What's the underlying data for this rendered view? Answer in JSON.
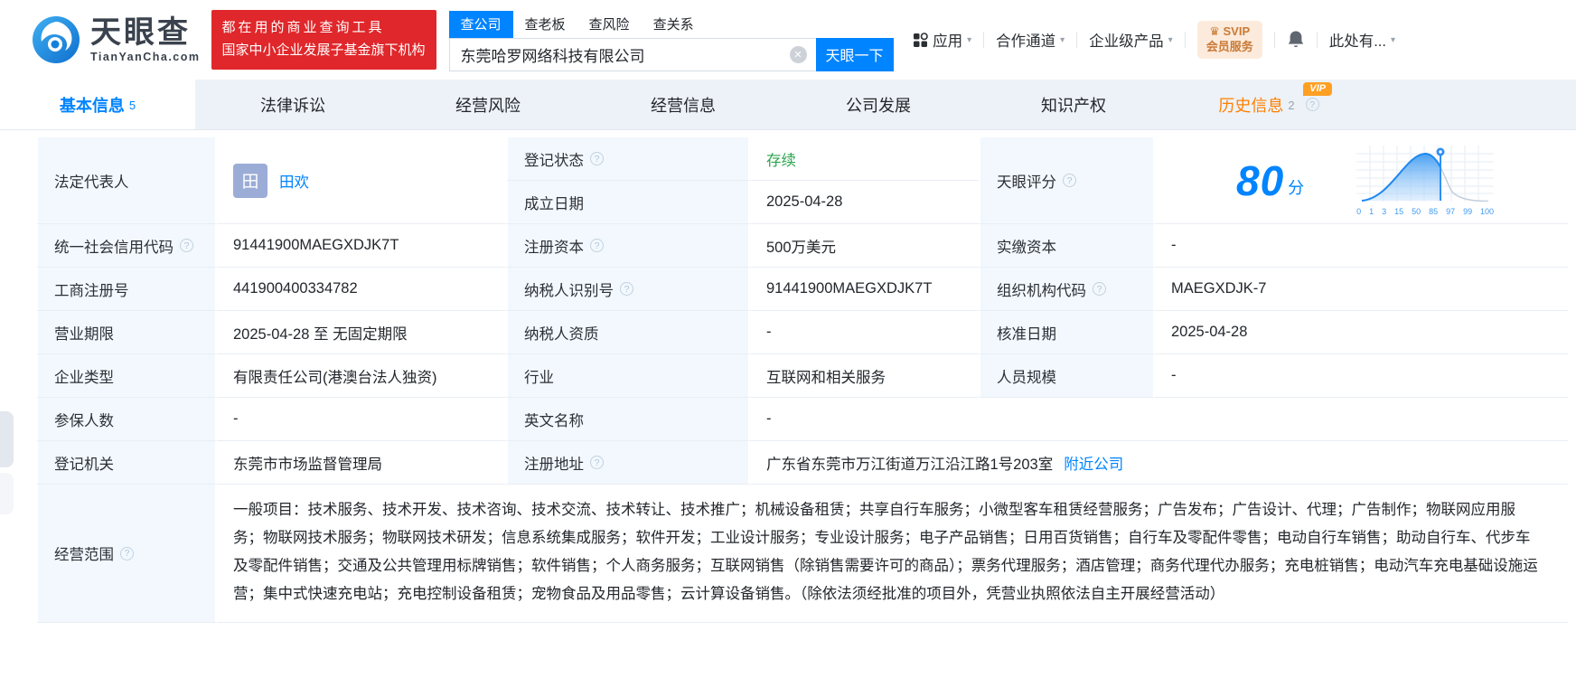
{
  "icons": {
    "help": "?",
    "caret": "▾",
    "crown": "♛",
    "clear": "✕"
  },
  "header": {
    "logo_title": "天眼查",
    "logo_domain": "TianYanCha.com",
    "promo_line1": "都在用的商业查询工具",
    "promo_line2": "国家中小企业发展子基金旗下机构",
    "search_tabs": [
      {
        "label": "查公司",
        "active": true
      },
      {
        "label": "查老板",
        "active": false
      },
      {
        "label": "查风险",
        "active": false
      },
      {
        "label": "查关系",
        "active": false
      }
    ],
    "search_value": "东莞哈罗网络科技有限公司",
    "search_button": "天眼一下",
    "nav_app": "应用",
    "nav_coop": "合作通道",
    "nav_enterprise": "企业级产品",
    "svip_line1": "SVIP",
    "svip_line2": "会员服务",
    "nav_more": "此处有..."
  },
  "tabbar": {
    "basic": "基本信息",
    "basic_count": "5",
    "legal": "法律诉讼",
    "risk": "经营风险",
    "operation": "经营信息",
    "development": "公司发展",
    "ip": "知识产权",
    "history": "历史信息",
    "history_count": "2",
    "history_vip": "VIP"
  },
  "table": {
    "legal_rep": {
      "label": "法定代表人",
      "avatar": "田",
      "name": "田欢"
    },
    "reg_status": {
      "label": "登记状态",
      "value": "存续"
    },
    "est_date": {
      "label": "成立日期",
      "value": "2025-04-28"
    },
    "score": {
      "label": "天眼评分",
      "value": "80",
      "unit": "分"
    },
    "credit_code": {
      "label": "统一社会信用代码",
      "value": "91441900MAEGXDJK7T"
    },
    "reg_capital": {
      "label": "注册资本",
      "value": "500万美元"
    },
    "paid_capital": {
      "label": "实缴资本",
      "value": "-"
    },
    "reg_number": {
      "label": "工商注册号",
      "value": "441900400334782"
    },
    "taxpayer_id": {
      "label": "纳税人识别号",
      "value": "91441900MAEGXDJK7T"
    },
    "org_code": {
      "label": "组织机构代码",
      "value": "MAEGXDJK-7"
    },
    "term": {
      "label": "营业期限",
      "value": "2025-04-28 至 无固定期限"
    },
    "taxpayer_quality": {
      "label": "纳税人资质",
      "value": "-"
    },
    "approval_date": {
      "label": "核准日期",
      "value": "2025-04-28"
    },
    "company_type": {
      "label": "企业类型",
      "value": "有限责任公司(港澳台法人独资)"
    },
    "industry": {
      "label": "行业",
      "value": "互联网和相关服务"
    },
    "staff_size": {
      "label": "人员规模",
      "value": "-"
    },
    "insured": {
      "label": "参保人数",
      "value": "-"
    },
    "english_name": {
      "label": "英文名称",
      "value": "-"
    },
    "reg_authority": {
      "label": "登记机关",
      "value": "东莞市市场监督管理局"
    },
    "reg_address": {
      "label": "注册地址",
      "value": "广东省东莞市万江街道万江沿江路1号203室",
      "link": "附近公司"
    },
    "scope": {
      "label": "经营范围",
      "text": "一般项目：技术服务、技术开发、技术咨询、技术交流、技术转让、技术推广；机械设备租赁；共享自行车服务；小微型客车租赁经营服务；广告发布；广告设计、代理；广告制作；物联网应用服务；物联网技术服务；物联网技术研发；信息系统集成服务；软件开发；工业设计服务；专业设计服务；电子产品销售；日用百货销售；自行车及零配件零售；电动自行车销售；助动自行车、代步车及零配件销售；交通及公共管理用标牌销售；软件销售；个人商务服务；互联网销售（除销售需要许可的商品）；票务代理服务；酒店管理；商务代理代办服务；充电桩销售；电动汽车充电基础设施运营；集中式快速充电站；充电控制设备租赁；宠物食品及用品零售；云计算设备销售。（除依法须经批准的项目外，凭营业执照依法自主开展经营活动）"
    }
  },
  "chart_data": {
    "type": "area",
    "title": "天眼评分",
    "score": 80,
    "x_ticks": [
      "0",
      "1",
      "3",
      "15",
      "50",
      "85",
      "97",
      "99",
      "100"
    ],
    "marker_tick": "85",
    "description": "bell-curve score distribution, blue filled area up to marker pin, gray tail to the right",
    "accent_color": "#0084ff"
  },
  "colors": {
    "accent": "#0084ff",
    "status_green": "#2da44e",
    "history_orange": "#ff8000",
    "promo_red": "#e0272b"
  }
}
